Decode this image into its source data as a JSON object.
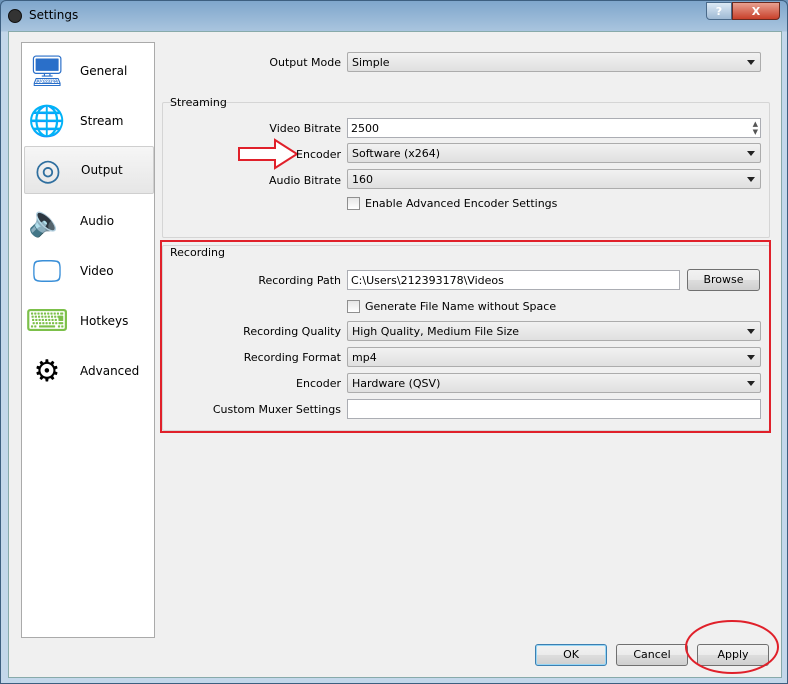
{
  "window": {
    "title": "Settings",
    "help": "?",
    "close": "X"
  },
  "sidebar": {
    "items": [
      {
        "label": "General",
        "icon": "general-tools-icon"
      },
      {
        "label": "Stream",
        "icon": "globe-icon"
      },
      {
        "label": "Output",
        "icon": "broadcast-icon",
        "selected": true
      },
      {
        "label": "Audio",
        "icon": "speaker-icon"
      },
      {
        "label": "Video",
        "icon": "monitor-icon"
      },
      {
        "label": "Hotkeys",
        "icon": "keyboard-icon"
      },
      {
        "label": "Advanced",
        "icon": "gears-icon"
      }
    ]
  },
  "output_mode": {
    "label": "Output Mode",
    "value": "Simple"
  },
  "streaming": {
    "title": "Streaming",
    "video_bitrate": {
      "label": "Video Bitrate",
      "value": "2500"
    },
    "encoder": {
      "label": "Encoder",
      "value": "Software (x264)"
    },
    "audio_bitrate": {
      "label": "Audio Bitrate",
      "value": "160"
    },
    "advanced": {
      "label": "Enable Advanced Encoder Settings",
      "checked": false
    }
  },
  "recording": {
    "title": "Recording",
    "path": {
      "label": "Recording Path",
      "value": "C:\\Users\\212393178\\Videos"
    },
    "browse": "Browse",
    "nospace": {
      "label": "Generate File Name without Space",
      "checked": false
    },
    "quality": {
      "label": "Recording Quality",
      "value": "High Quality, Medium File Size"
    },
    "format": {
      "label": "Recording Format",
      "value": "mp4"
    },
    "encoder": {
      "label": "Encoder",
      "value": "Hardware (QSV)"
    },
    "muxer": {
      "label": "Custom Muxer Settings",
      "value": ""
    }
  },
  "buttons": {
    "ok": "OK",
    "cancel": "Cancel",
    "apply": "Apply"
  },
  "annotation_color": "#e0202a"
}
